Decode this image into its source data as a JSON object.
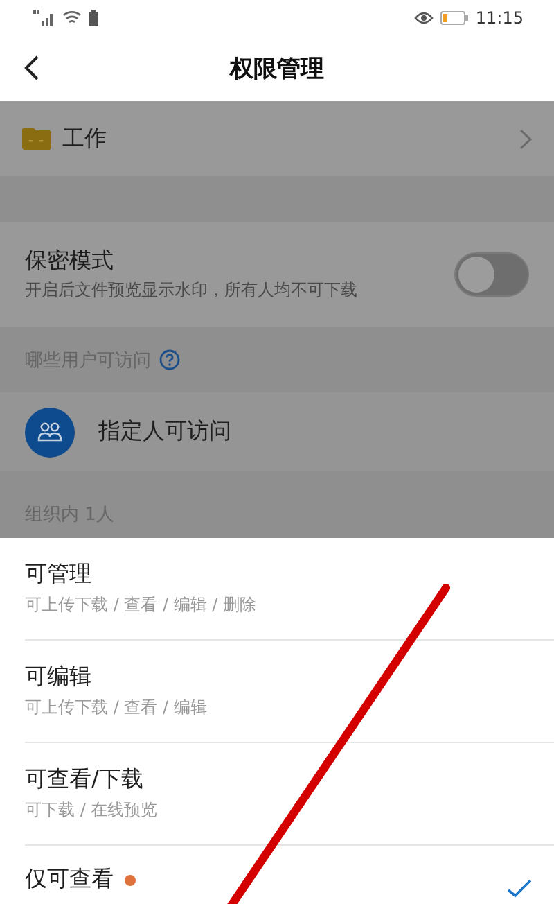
{
  "status_bar": {
    "time": "11:15"
  },
  "header": {
    "title": "权限管理"
  },
  "folder": {
    "name": "工作"
  },
  "secret_mode": {
    "title": "保密模式",
    "description": "开启后文件预览显示水印，所有人均不可下载",
    "on": false
  },
  "access_section": {
    "heading": "哪些用户可访问"
  },
  "access": {
    "label": "指定人可访问"
  },
  "members_heading": "组织内 1人",
  "permission_options": [
    {
      "title": "可管理",
      "description": "可上传下载 / 查看 / 编辑 / 删除",
      "new_dot": false,
      "selected": false
    },
    {
      "title": "可编辑",
      "description": "可上传下载 / 查看 / 编辑",
      "new_dot": false,
      "selected": false
    },
    {
      "title": "可查看/下载",
      "description": "可下载 / 在线预览",
      "new_dot": false,
      "selected": false
    },
    {
      "title": "仅可查看",
      "new_dot": true,
      "selected": true
    }
  ]
}
